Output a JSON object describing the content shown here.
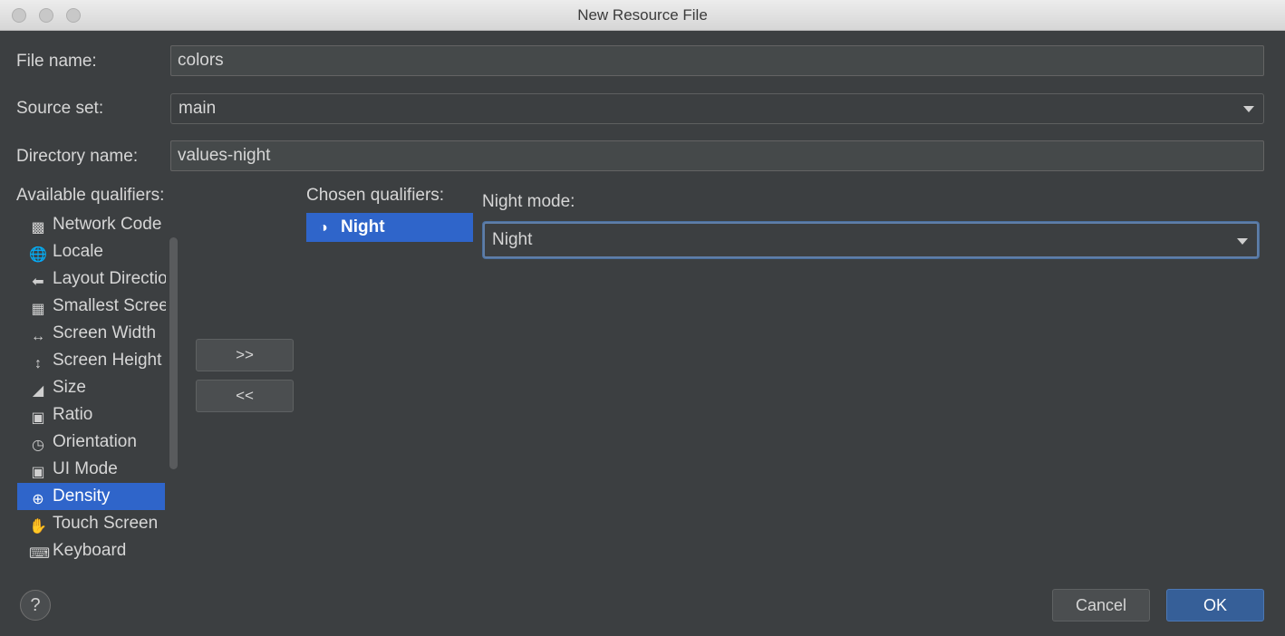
{
  "window": {
    "title": "New Resource File"
  },
  "form": {
    "file_name_label": "File name:",
    "file_name_value": "colors",
    "source_set_label": "Source set:",
    "source_set_value": "main",
    "directory_name_label": "Directory name:",
    "directory_name_value": "values-night"
  },
  "qualifiers": {
    "available_label": "Available qualifiers:",
    "chosen_label": "Chosen qualifiers:",
    "available": [
      {
        "label": "Network Code",
        "icon": "network-icon"
      },
      {
        "label": "Locale",
        "icon": "globe-icon"
      },
      {
        "label": "Layout Direction",
        "icon": "layout-direction-icon"
      },
      {
        "label": "Smallest Screen Width",
        "icon": "smallest-screen-icon"
      },
      {
        "label": "Screen Width",
        "icon": "screen-width-icon"
      },
      {
        "label": "Screen Height",
        "icon": "screen-height-icon"
      },
      {
        "label": "Size",
        "icon": "size-icon"
      },
      {
        "label": "Ratio",
        "icon": "ratio-icon"
      },
      {
        "label": "Orientation",
        "icon": "orientation-icon"
      },
      {
        "label": "UI Mode",
        "icon": "ui-mode-icon"
      },
      {
        "label": "Density",
        "icon": "density-icon"
      },
      {
        "label": "Touch Screen",
        "icon": "touch-screen-icon"
      },
      {
        "label": "Keyboard",
        "icon": "keyboard-icon"
      }
    ],
    "selected_available": "Density",
    "chosen": [
      {
        "label": "Night",
        "icon": "moon-icon"
      }
    ],
    "add_button": ">>",
    "remove_button": "<<"
  },
  "night_mode": {
    "label": "Night mode:",
    "value": "Night"
  },
  "buttons": {
    "help": "?",
    "cancel": "Cancel",
    "ok": "OK"
  },
  "colors": {
    "background": "#3c3f41",
    "selection": "#2f65ca",
    "ok_button": "#365f98"
  }
}
